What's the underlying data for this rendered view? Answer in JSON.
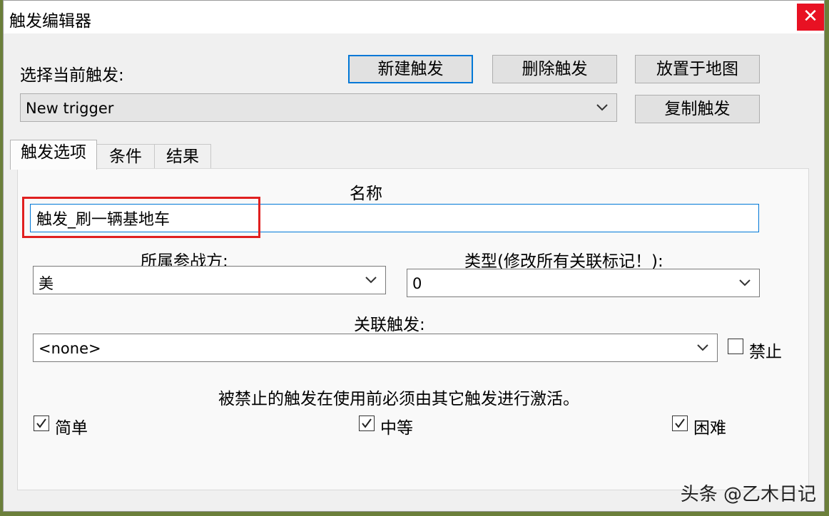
{
  "window": {
    "title": "触发编辑器",
    "close_glyph": "✕"
  },
  "select_label": "选择当前触发:",
  "buttons": {
    "new": "新建触发",
    "delete": "删除触发",
    "place": "放置于地图",
    "copy": "复制触发"
  },
  "current_trigger": {
    "value": "New trigger"
  },
  "tabs": [
    {
      "label": "触发选项"
    },
    {
      "label": "条件"
    },
    {
      "label": "结果"
    }
  ],
  "panel": {
    "name_label": "名称",
    "name_value": "触发_刷一辆基地车",
    "side_label": "所属参战方:",
    "side_value": "美",
    "type_label": "类型(修改所有关联标记！):",
    "type_value": "0",
    "linked_label": "关联触发:",
    "linked_value": "<none>",
    "disabled_label": "禁止",
    "disabled_checked": false,
    "note": "被禁止的触发在使用前必须由其它触发进行激活。",
    "difficulty": [
      {
        "label": "简单",
        "checked": true
      },
      {
        "label": "中等",
        "checked": true
      },
      {
        "label": "困难",
        "checked": true
      }
    ]
  },
  "watermark": "头条 @乙木日记",
  "colors": {
    "accent": "#0078d7",
    "close": "#e81123",
    "highlight": "#e02020"
  }
}
